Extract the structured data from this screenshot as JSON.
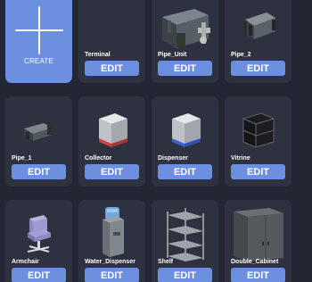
{
  "create": {
    "label": "CREATE"
  },
  "items": [
    {
      "name": "Terminal",
      "edit": "EDIT",
      "icon": "terminal-icon"
    },
    {
      "name": "Pipe_Unit",
      "edit": "EDIT",
      "icon": "pipe-unit-icon"
    },
    {
      "name": "Pipe_2",
      "edit": "EDIT",
      "icon": "pipe-2-icon"
    },
    {
      "name": "Pipe_1",
      "edit": "EDIT",
      "icon": "pipe-1-icon"
    },
    {
      "name": "Collector",
      "edit": "EDIT",
      "icon": "collector-icon"
    },
    {
      "name": "Dispenser",
      "edit": "EDIT",
      "icon": "dispenser-icon"
    },
    {
      "name": "Vitrine",
      "edit": "EDIT",
      "icon": "vitrine-icon"
    },
    {
      "name": "Armchair",
      "edit": "EDIT",
      "icon": "armchair-icon"
    },
    {
      "name": "Water_Dispenser",
      "edit": "EDIT",
      "icon": "water-dispenser-icon"
    },
    {
      "name": "Shelf",
      "edit": "EDIT",
      "icon": "shelf-icon"
    },
    {
      "name": "Double_Cabinet",
      "edit": "EDIT",
      "icon": "double-cabinet-icon"
    }
  ],
  "colors": {
    "background": "#242733",
    "card": "#2e3140",
    "accent": "#6c8fe0",
    "text": "#ffffff"
  }
}
